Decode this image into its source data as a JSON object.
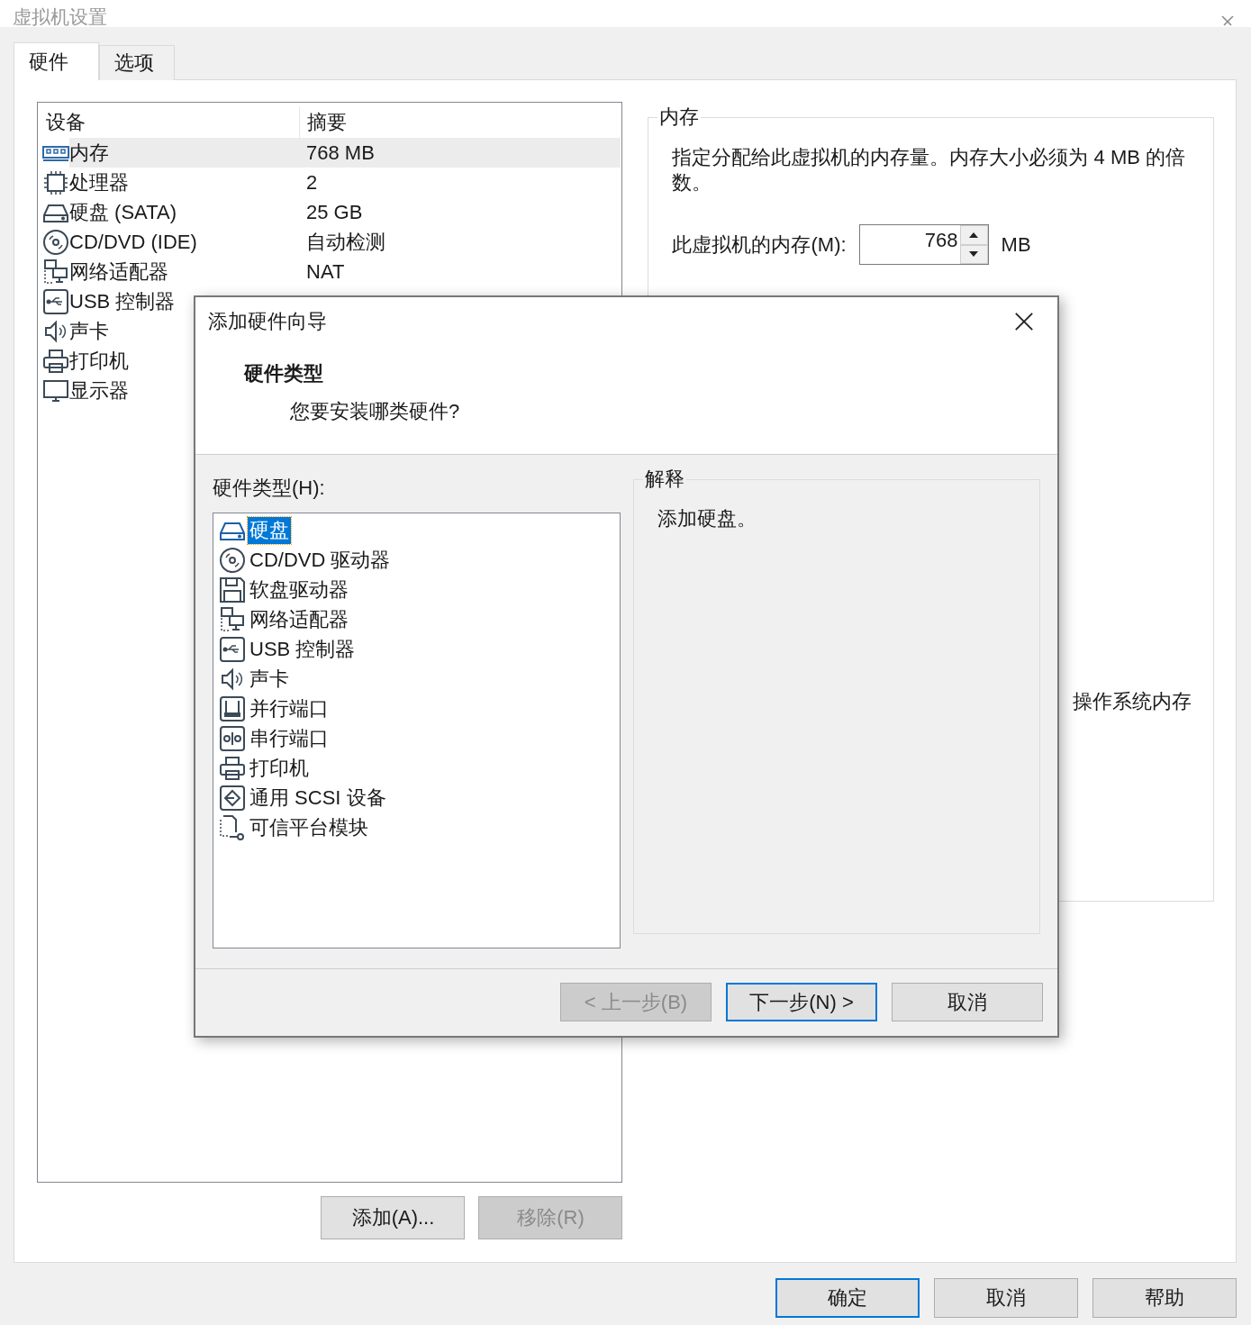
{
  "window": {
    "title": "虚拟机设置"
  },
  "tabs": [
    {
      "label": "硬件",
      "selected": true
    },
    {
      "label": "选项",
      "selected": false
    }
  ],
  "device_table": {
    "columns": [
      "设备",
      "摘要"
    ],
    "rows": [
      {
        "kind": "memory",
        "device": "内存",
        "summary": "768 MB",
        "selected": true
      },
      {
        "kind": "cpu",
        "device": "处理器",
        "summary": "2",
        "selected": false
      },
      {
        "kind": "disk",
        "device": "硬盘 (SATA)",
        "summary": "25 GB",
        "selected": false
      },
      {
        "kind": "cdrom",
        "device": "CD/DVD (IDE)",
        "summary": "自动检测",
        "selected": false
      },
      {
        "kind": "network",
        "device": "网络适配器",
        "summary": "NAT",
        "selected": false
      },
      {
        "kind": "usb",
        "device": "USB 控制器",
        "selected": false
      },
      {
        "kind": "sound",
        "device": "声卡",
        "selected": false
      },
      {
        "kind": "printer",
        "device": "打印机",
        "selected": false
      },
      {
        "kind": "display",
        "device": "显示器",
        "selected": false
      }
    ]
  },
  "device_buttons": [
    {
      "label": "添加(A)...",
      "disabled": false
    },
    {
      "label": "移除(R)",
      "disabled": true
    }
  ],
  "memory_group": {
    "title": "内存",
    "description": "指定分配给此虚拟机的内存量。内存大小必须为 4 MB 的倍数。",
    "field_label": "此虚拟机的内存(M):",
    "value": "768",
    "unit": "MB",
    "note": "操作系统内存"
  },
  "dialog_buttons": [
    {
      "label": "确定",
      "default": true
    },
    {
      "label": "取消",
      "default": false
    },
    {
      "label": "帮助",
      "default": false
    }
  ],
  "wizard": {
    "title": "添加硬件向导",
    "heading": "硬件类型",
    "subheading": "您要安装哪类硬件?",
    "list_label": "硬件类型(H):",
    "items": [
      {
        "kind": "disk",
        "label": "硬盘",
        "selected": true
      },
      {
        "kind": "cdrom",
        "label": "CD/DVD 驱动器",
        "selected": false
      },
      {
        "kind": "floppy",
        "label": "软盘驱动器",
        "selected": false
      },
      {
        "kind": "network",
        "label": "网络适配器",
        "selected": false
      },
      {
        "kind": "usb",
        "label": "USB 控制器",
        "selected": false
      },
      {
        "kind": "sound",
        "label": "声卡",
        "selected": false
      },
      {
        "kind": "parallel",
        "label": "并行端口",
        "selected": false
      },
      {
        "kind": "serial",
        "label": "串行端口",
        "selected": false
      },
      {
        "kind": "printer",
        "label": "打印机",
        "selected": false
      },
      {
        "kind": "scsi",
        "label": "通用 SCSI 设备",
        "selected": false
      },
      {
        "kind": "tpm",
        "label": "可信平台模块",
        "selected": false
      }
    ],
    "explanation_title": "解释",
    "explanation": "添加硬盘。",
    "buttons": [
      {
        "label": "< 上一步(B)",
        "disabled": true,
        "default": false
      },
      {
        "label": "下一步(N) >",
        "disabled": false,
        "default": true
      },
      {
        "label": "取消",
        "disabled": false,
        "default": false
      }
    ]
  }
}
